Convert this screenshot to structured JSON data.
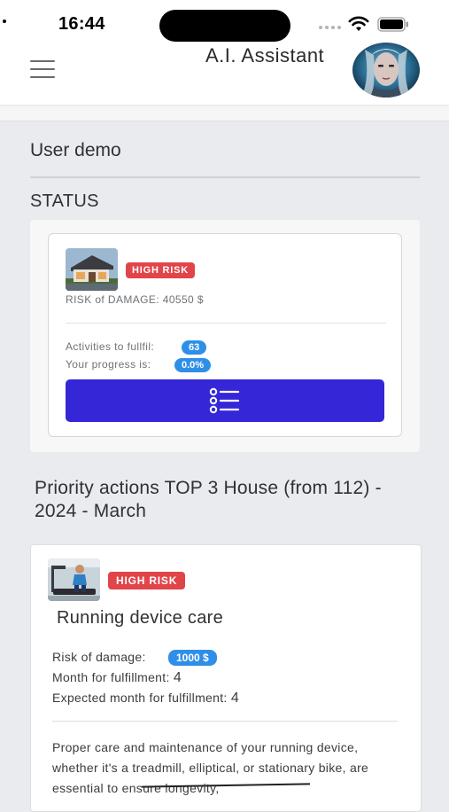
{
  "status_bar": {
    "time": "16:44"
  },
  "header": {
    "title": "A.I. Assistant"
  },
  "page": {
    "title": "User demo",
    "section": "STATUS"
  },
  "status_card": {
    "badge": "HIGH RISK",
    "risk_of_damage": "RISK of DAMAGE: 40550 $",
    "activities_label": "Activities to fullfil:",
    "activities_value": "63",
    "progress_label": "Your progress is:",
    "progress_value": "0.0%"
  },
  "priority": {
    "title": "Priority actions TOP 3 House (from 112) - 2024 - March"
  },
  "action": {
    "badge": "HIGH RISK",
    "title": "Running device care",
    "risk_label": "Risk of damage:",
    "risk_value": "1000 $",
    "month_label": "Month for fulfillment:",
    "month_value": "4",
    "expected_label": "Expected month for fulfillment:",
    "expected_value": "4",
    "description": "Proper care and maintenance of your running device, whether it's a treadmill, elliptical, or stationary bike, are essential to ensure longevity,"
  },
  "colors": {
    "accent": "#3526d8",
    "risk_badge": "#e0454a",
    "pill": "#2f8fe8",
    "background": "#e9ebee"
  },
  "icons": [
    "hamburger-menu-icon",
    "wifi-icon",
    "battery-icon",
    "list-icon",
    "house-thumbnail",
    "treadmill-thumbnail",
    "avatar"
  ]
}
